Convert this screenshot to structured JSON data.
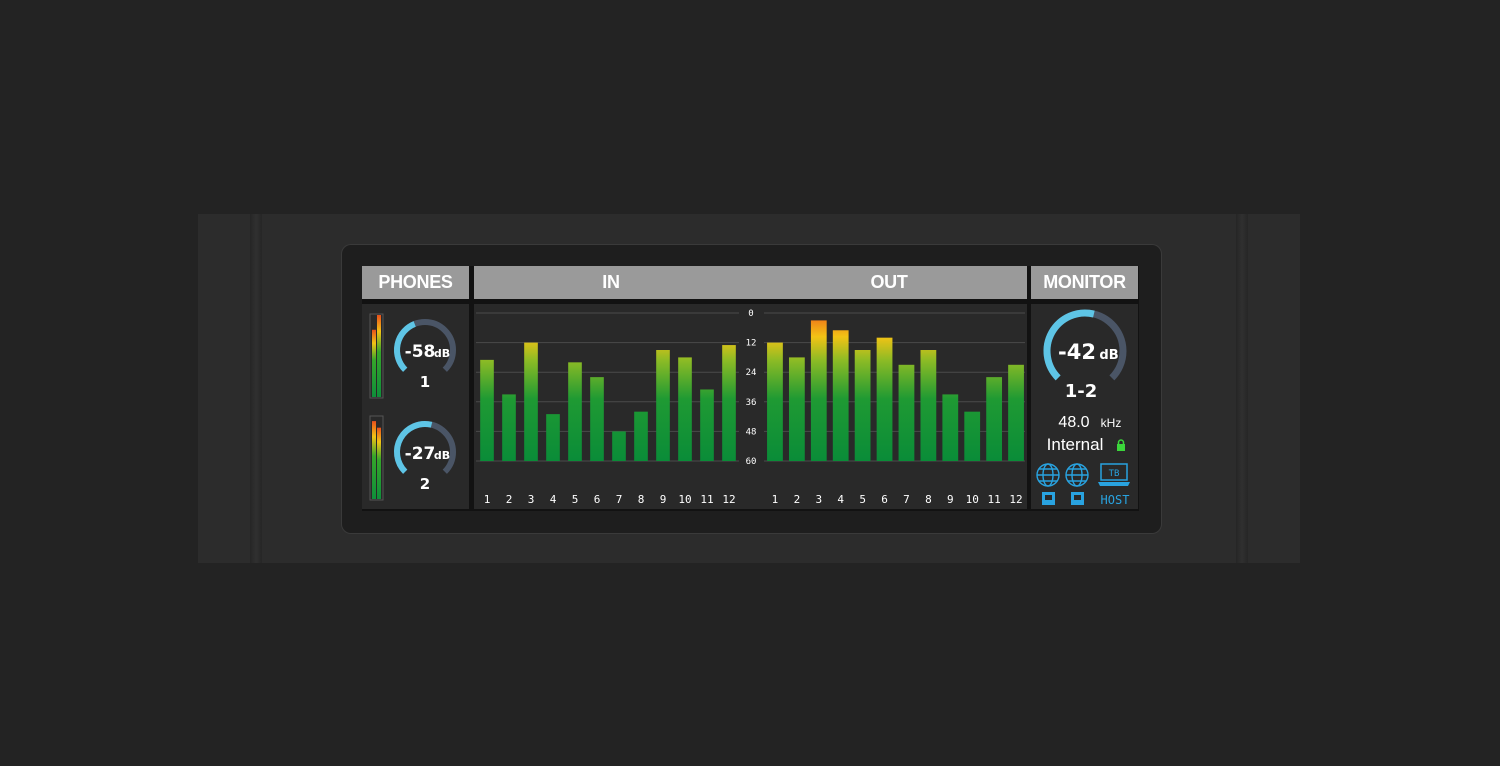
{
  "headers": {
    "phones": "PHONES",
    "in": "IN",
    "out": "OUT",
    "monitor": "MONITOR"
  },
  "phones": [
    {
      "value": "-58",
      "unit": "dB",
      "label": "1",
      "meter_levels": [
        0.82,
        1.0
      ]
    },
    {
      "value": "-27",
      "unit": "dB",
      "label": "2",
      "meter_levels": [
        0.95,
        0.87
      ]
    }
  ],
  "scale_labels": [
    "0",
    "12",
    "24",
    "36",
    "48",
    "60"
  ],
  "meter_db_range": [
    -60,
    0
  ],
  "in_channels": [
    "1",
    "2",
    "3",
    "4",
    "5",
    "6",
    "7",
    "8",
    "9",
    "10",
    "11",
    "12"
  ],
  "in_levels_db": [
    -19,
    -33,
    -12,
    -41,
    -20,
    -26,
    -48,
    -40,
    -15,
    -18,
    -31,
    -13
  ],
  "out_channels": [
    "1",
    "2",
    "3",
    "4",
    "5",
    "6",
    "7",
    "8",
    "9",
    "10",
    "11",
    "12"
  ],
  "out_levels_db": [
    -12,
    -18,
    -3,
    -7,
    -15,
    -10,
    -21,
    -15,
    -33,
    -40,
    -26,
    -21
  ],
  "monitor": {
    "value": "-42",
    "unit": "dB",
    "channel": "1-2",
    "sample_rate": "48.0",
    "rate_unit": "kHz",
    "clock_source": "Internal",
    "host_label": "HOST",
    "tb_label": "TB",
    "knob_level": 0.55
  },
  "colors": {
    "accent": "#5ec5e6",
    "knob_track": "#4a5566",
    "meter_green": "#0f8f3a",
    "meter_yellow": "#f2c315",
    "meter_red": "#e8501c",
    "lock": "#3bd63b",
    "icon_blue": "#29a3e0"
  },
  "icons": [
    "globe-icon",
    "globe-icon",
    "network-port-icon",
    "network-port-icon",
    "laptop-tb-icon",
    "lock-icon"
  ]
}
